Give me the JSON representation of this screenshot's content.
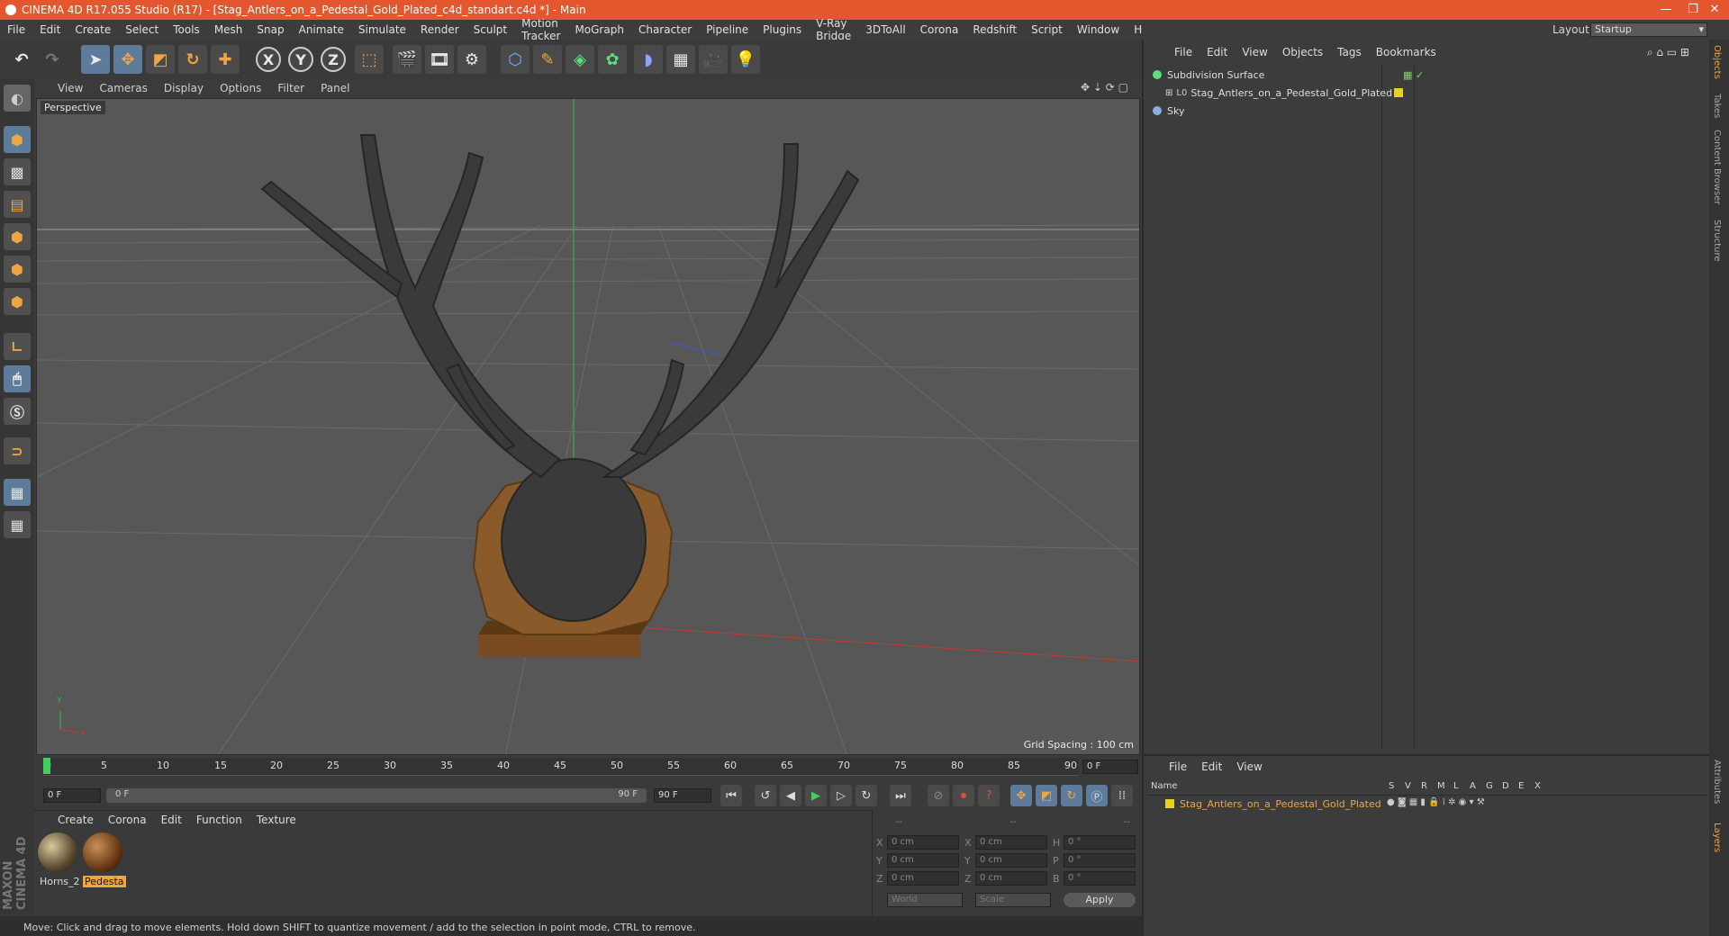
{
  "app": {
    "title": "CINEMA 4D R17.055 Studio (R17) - [Stag_Antlers_on_a_Pedestal_Gold_Plated_c4d_standart.c4d *] - Main",
    "layout_label": "Layout:",
    "layout_value": "Startup"
  },
  "menu": [
    "File",
    "Edit",
    "Create",
    "Select",
    "Tools",
    "Mesh",
    "Snap",
    "Animate",
    "Simulate",
    "Render",
    "Sculpt",
    "Motion Tracker",
    "MoGraph",
    "Character",
    "Pipeline",
    "Plugins",
    "V-Ray Bridge",
    "3DToAll",
    "Corona",
    "Redshift",
    "Script",
    "Window",
    "Help"
  ],
  "toolbar": {
    "axis_x": "X",
    "axis_y": "Y",
    "axis_z": "Z"
  },
  "viewport": {
    "menu": [
      "View",
      "Cameras",
      "Display",
      "Options",
      "Filter",
      "Panel"
    ],
    "camera_label": "Perspective",
    "grid_spacing": "Grid Spacing : 100 cm",
    "axis_y": "Y",
    "axis_x": "X"
  },
  "timeline": {
    "ticks": [
      "0",
      "5",
      "10",
      "15",
      "20",
      "25",
      "30",
      "35",
      "40",
      "45",
      "50",
      "55",
      "60",
      "65",
      "70",
      "75",
      "80",
      "85",
      "90"
    ],
    "current_frame": "0 F",
    "start_field": "0 F",
    "range_start": "0 F",
    "range_end": "90 F",
    "end_field": "90 F"
  },
  "materials": {
    "menu": [
      "Create",
      "Corona",
      "Edit",
      "Function",
      "Texture"
    ],
    "items": [
      {
        "name": "Horns_2"
      },
      {
        "name": "Pedesta"
      }
    ]
  },
  "coords": {
    "header": [
      "--",
      "--",
      "--"
    ],
    "rows": [
      {
        "l1": "X",
        "v1": "0 cm",
        "l2": "X",
        "v2": "0 cm",
        "l3": "H",
        "v3": "0 °"
      },
      {
        "l1": "Y",
        "v1": "0 cm",
        "l2": "Y",
        "v2": "0 cm",
        "l3": "P",
        "v3": "0 °"
      },
      {
        "l1": "Z",
        "v1": "0 cm",
        "l2": "Z",
        "v2": "0 cm",
        "l3": "B",
        "v3": "0 °"
      }
    ],
    "world": "World",
    "scale": "Scale",
    "apply": "Apply"
  },
  "objects": {
    "menu": [
      "File",
      "Edit",
      "View",
      "Objects",
      "Tags",
      "Bookmarks"
    ],
    "items": [
      {
        "name": "Subdivision Surface"
      },
      {
        "name": "Stag_Antlers_on_a_Pedestal_Gold_Plated"
      },
      {
        "name": "Sky"
      }
    ]
  },
  "layers": {
    "menu": [
      "File",
      "Edit",
      "View"
    ],
    "header_name": "Name",
    "columns": [
      "S",
      "V",
      "R",
      "M",
      "L",
      "A",
      "G",
      "D",
      "E",
      "X"
    ],
    "row": "Stag_Antlers_on_a_Pedestal_Gold_Plated"
  },
  "right_tabs": [
    "Objects",
    "Takes",
    "Content Browser",
    "Structure",
    "Attributes",
    "Layers"
  ],
  "status": "Move: Click and drag to move elements. Hold down SHIFT to quantize movement / add to the selection in point mode, CTRL to remove.",
  "brand": "MAXON CINEMA 4D",
  "colors": {
    "accent": "#e4572e",
    "selection": "#5d7c9c",
    "gold": "#f0a640"
  }
}
